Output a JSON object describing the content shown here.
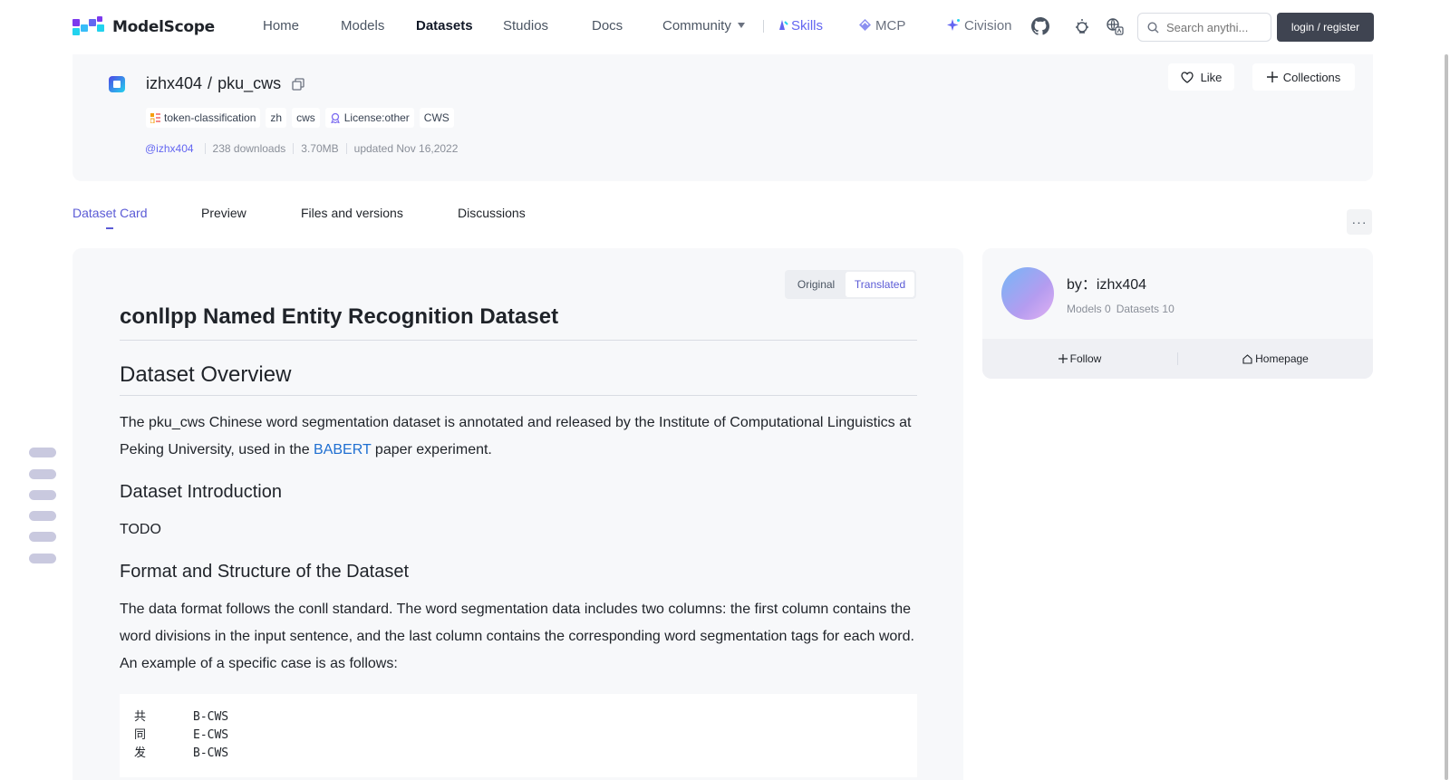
{
  "brand": {
    "name": "ModelScope"
  },
  "nav": {
    "home": "Home",
    "models": "Models",
    "datasets": "Datasets",
    "studios": "Studios",
    "docs": "Docs",
    "community": "Community",
    "skills": "Skills",
    "mcp": "MCP",
    "civision": "Civision"
  },
  "search": {
    "placeholder": "Search anythi..."
  },
  "login_label": "login / register",
  "dataset": {
    "owner": "izhx404",
    "separator": "/",
    "name": "pku_cws",
    "tags": [
      "token-classification",
      "zh",
      "cws",
      "License:other",
      "CWS"
    ],
    "author_handle": "@izhx404",
    "downloads": "238 downloads",
    "size": "3.70MB",
    "updated": "updated Nov 16,2022"
  },
  "actions": {
    "like": "Like",
    "collections": "Collections"
  },
  "tabs": [
    "Dataset Card",
    "Preview",
    "Files and versions",
    "Discussions"
  ],
  "more_label": "···",
  "toggle": {
    "original": "Original",
    "translated": "Translated"
  },
  "card": {
    "title": "conllpp Named Entity Recognition Dataset",
    "overview_heading": "Dataset Overview",
    "overview_before": "The pku_cws Chinese word segmentation dataset is annotated and released by the Institute of Computational Linguistics at Peking University, used in the ",
    "overview_link": "BABERT",
    "overview_after": " paper experiment.",
    "intro_heading": "Dataset Introduction",
    "intro_text": "TODO",
    "format_heading": "Format and Structure of the Dataset",
    "format_text": "The data format follows the conll standard. The word segmentation data includes two columns: the first column contains the word divisions in the input sentence, and the last column contains the corresponding word segmentation tags for each word. An example of a specific case is as follows:",
    "code_rows": [
      [
        "共",
        "B-CWS"
      ],
      [
        "同",
        "E-CWS"
      ],
      [
        "发",
        "B-CWS"
      ]
    ]
  },
  "author": {
    "by_label": "by：izhx404",
    "models": "Models 0",
    "datasets": "Datasets 10",
    "follow": "Follow",
    "homepage": "Homepage"
  },
  "colors": {
    "accent": "#5b5bd6",
    "link": "#1f6fd1",
    "login_bg": "#3f4451"
  }
}
